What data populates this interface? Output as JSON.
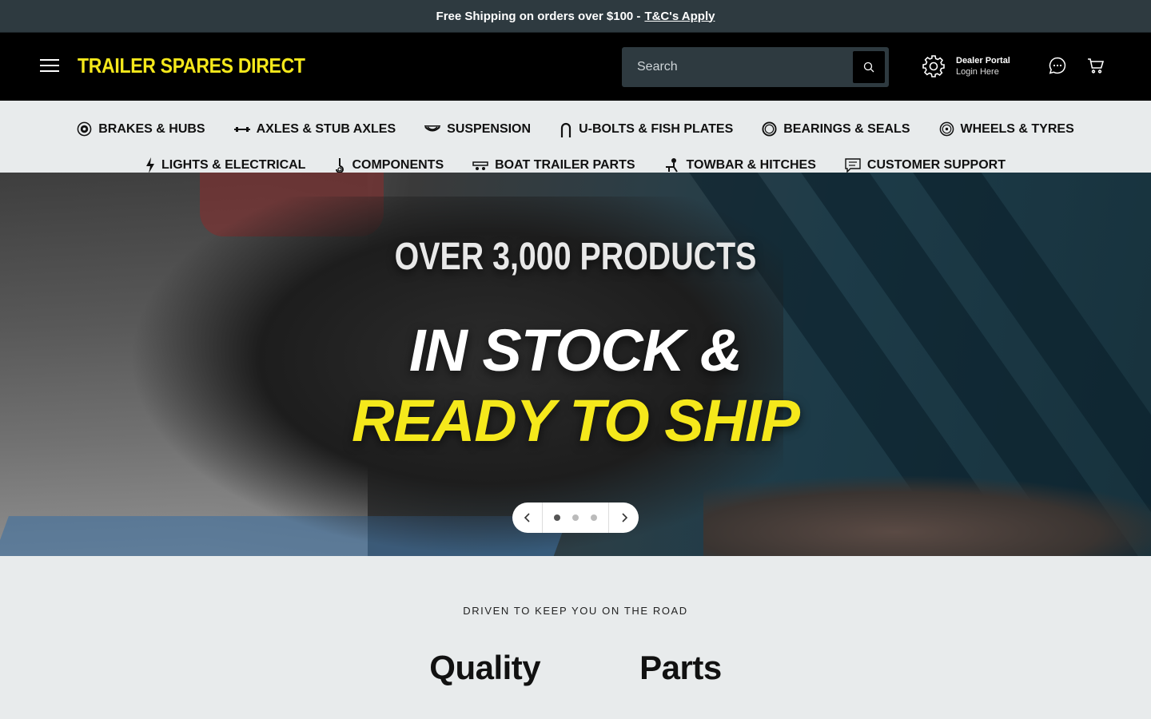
{
  "announcement": {
    "text": "Free Shipping on orders over $100 -",
    "link": "T&C's Apply"
  },
  "header": {
    "logo": "TRAILER SPARES DIRECT",
    "search_placeholder": "Search",
    "dealer_title": "Dealer Portal",
    "dealer_sub": "Login Here"
  },
  "nav": {
    "row1": [
      {
        "label": "BRAKES & HUBS",
        "icon": "brake-disc-icon"
      },
      {
        "label": "AXLES & STUB AXLES",
        "icon": "axle-icon"
      },
      {
        "label": "SUSPENSION",
        "icon": "leaf-spring-icon"
      },
      {
        "label": "U-BOLTS & FISH PLATES",
        "icon": "u-bolt-icon"
      },
      {
        "label": "BEARINGS & SEALS",
        "icon": "bearing-icon"
      },
      {
        "label": "WHEELS & TYRES",
        "icon": "wheel-icon"
      }
    ],
    "row2": [
      {
        "label": "LIGHTS & ELECTRICAL",
        "icon": "lightning-icon"
      },
      {
        "label": "COMPONENTS",
        "icon": "hook-icon"
      },
      {
        "label": "BOAT TRAILER PARTS",
        "icon": "boat-trailer-icon"
      },
      {
        "label": "TOWBAR & HITCHES",
        "icon": "hitch-icon"
      },
      {
        "label": "CUSTOMER SUPPORT",
        "icon": "support-chat-icon"
      }
    ]
  },
  "hero": {
    "line1": "OVER 3,000 PRODUCTS",
    "line2": "IN STOCK &",
    "line3": "READY TO SHIP",
    "slides": 3,
    "active_slide": 1
  },
  "section": {
    "eyebrow": "DRIVEN TO KEEP YOU ON THE ROAD",
    "word1": "Quality",
    "word2": "Parts"
  },
  "colors": {
    "accent_yellow": "#f5e81b",
    "dark_bar": "#2e3a40"
  }
}
